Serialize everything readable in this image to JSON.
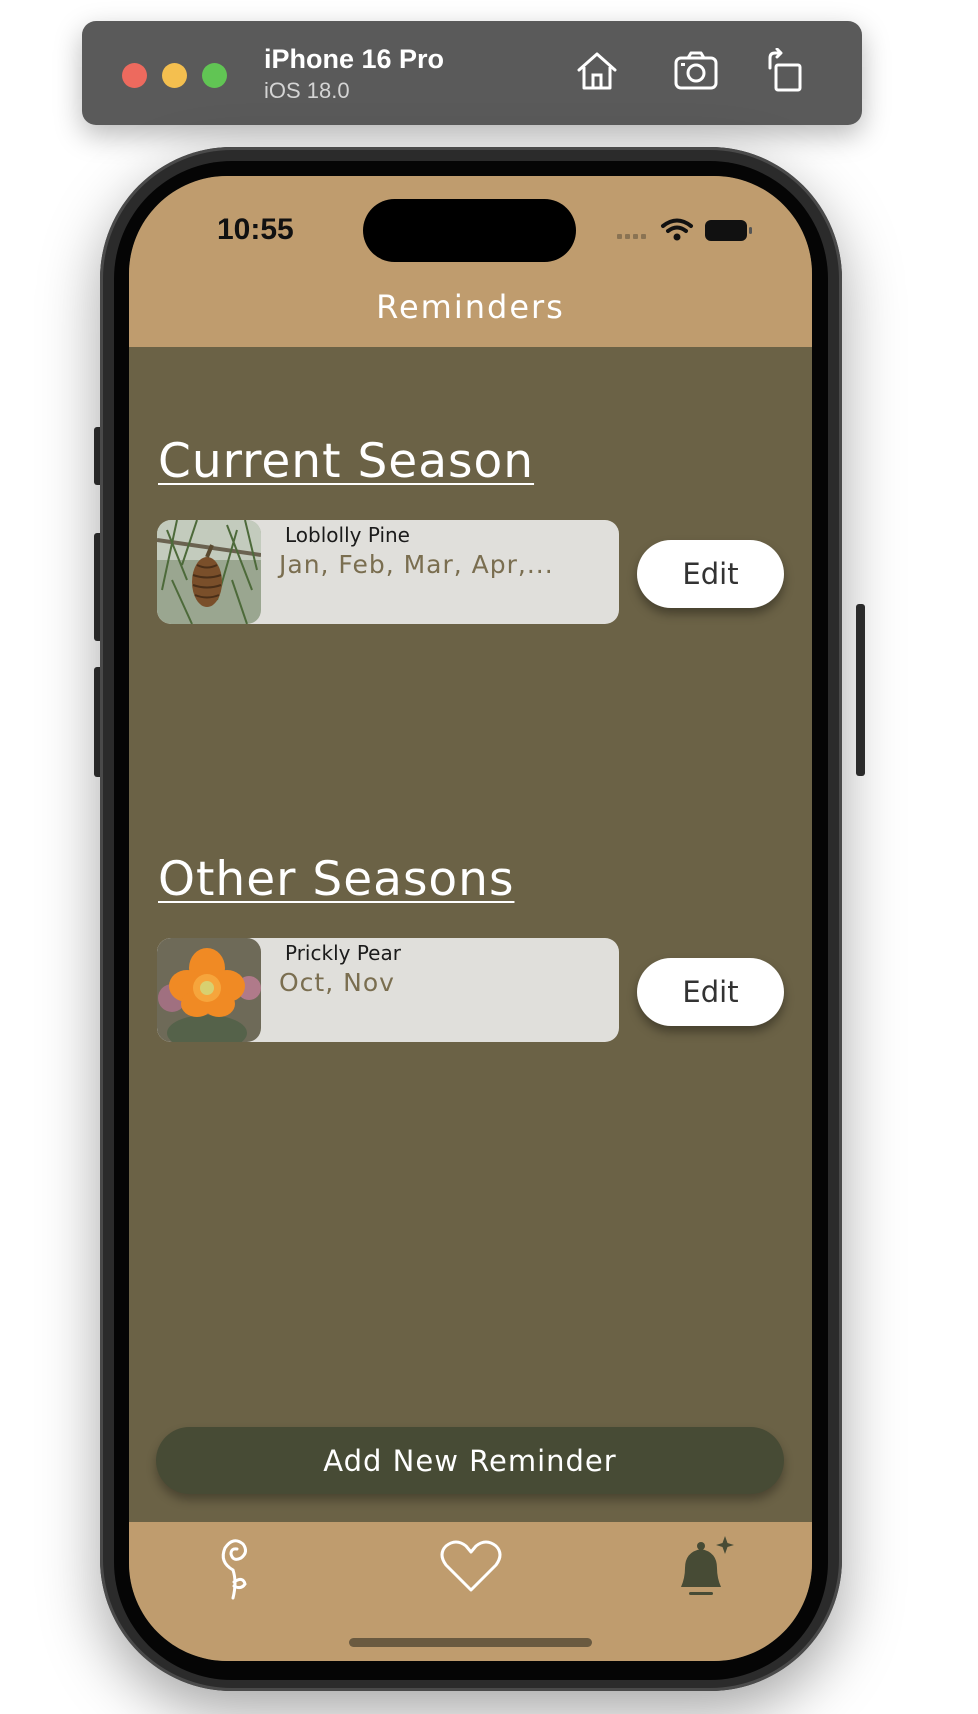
{
  "simulator": {
    "device_name": "iPhone 16 Pro",
    "os_version": "iOS 18.0",
    "buttons": [
      "home-icon",
      "screenshot-icon",
      "rotate-icon"
    ]
  },
  "status_bar": {
    "time": "10:55"
  },
  "nav": {
    "title": "Reminders"
  },
  "sections": {
    "current": {
      "title": "Current Season",
      "items": [
        {
          "name": "Loblolly Pine",
          "months": "Jan, Feb, Mar, Apr,...",
          "edit_label": "Edit",
          "image": "pine-cone-photo"
        }
      ]
    },
    "other": {
      "title": "Other Seasons",
      "items": [
        {
          "name": "Prickly Pear",
          "months": "Oct, Nov",
          "edit_label": "Edit",
          "image": "cactus-flower-photo"
        }
      ]
    }
  },
  "actions": {
    "add_label": "Add New Reminder"
  },
  "tabs": [
    "plant-sprout-icon",
    "heart-icon",
    "bell-icon"
  ],
  "colors": {
    "header": "#bf9c6e",
    "background": "#6b6246",
    "card": "#e0dfdb",
    "add_button": "#474b35",
    "months_text": "#7a6e50"
  }
}
